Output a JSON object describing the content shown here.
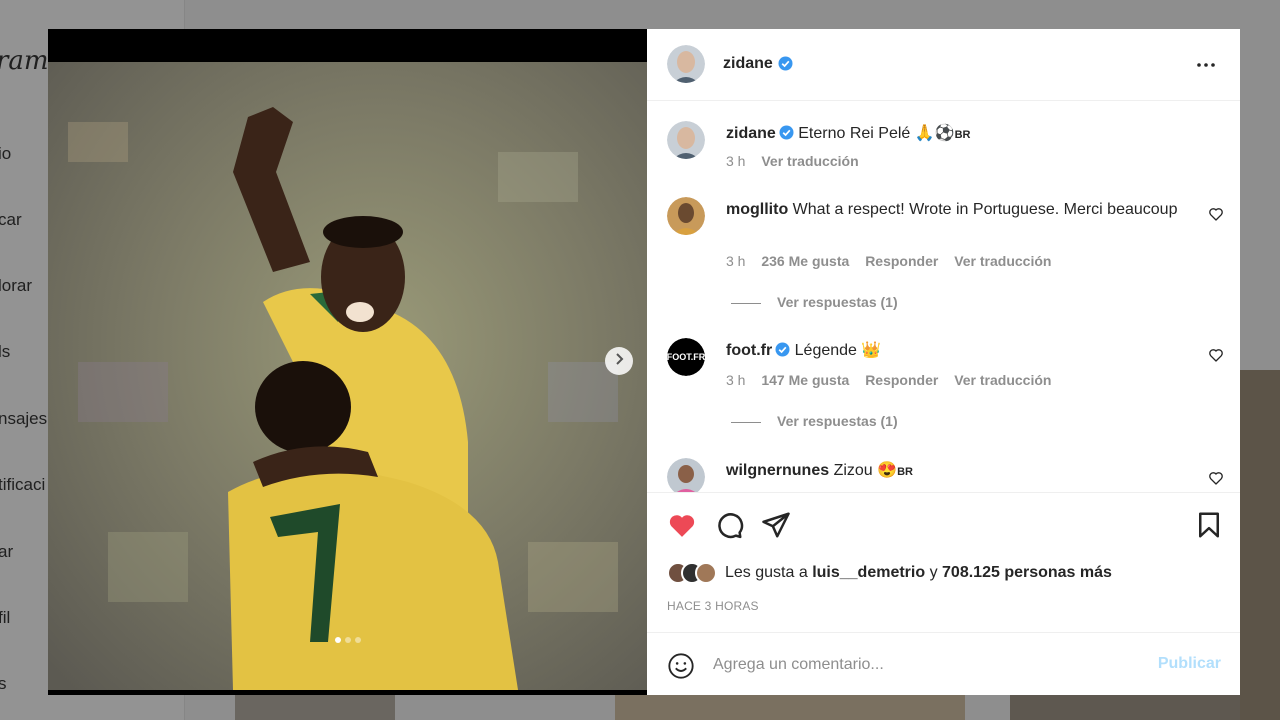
{
  "background": {
    "logo_fragment": "ram",
    "nav_fragments": [
      "io",
      "car",
      "lorar",
      "ls",
      "nsajes",
      "tificaci",
      "ar",
      "fil",
      "s"
    ]
  },
  "post": {
    "author": "zidane",
    "caption": "Eterno Rei Pelé 🙏⚽",
    "caption_flag": "BR",
    "caption_time": "3 h",
    "caption_translate": "Ver traducción",
    "more_icon": "more-horizontal-icon",
    "carousel_dots": 3,
    "carousel_active": 1
  },
  "comments": [
    {
      "username": "mogllito",
      "verified": false,
      "text": "What a respect! Wrote in Portuguese. Merci beaucoup",
      "time": "3 h",
      "likes": "236 Me gusta",
      "reply": "Responder",
      "translate": "Ver traducción",
      "view_replies": "Ver respuestas (1)"
    },
    {
      "username": "foot.fr",
      "verified": true,
      "text": "Légende 👑",
      "time": "3 h",
      "likes": "147 Me gusta",
      "reply": "Responder",
      "translate": "Ver traducción",
      "view_replies": "Ver respuestas (1)"
    },
    {
      "username": "wilgnernunes",
      "verified": false,
      "text": "Zizou 😍",
      "flag": "BR"
    }
  ],
  "likes": {
    "prefix": "Les gusta a",
    "user": "luis__demetrio",
    "joiner": "y",
    "others": "708.125 personas más"
  },
  "time_ago": "HACE 3 HORAS",
  "comment_box": {
    "placeholder": "Agrega un comentario...",
    "publish": "Publicar"
  },
  "colors": {
    "like_red": "#ed4956",
    "verified_blue": "#3897f0",
    "publish_disabled": "#b2dffc"
  }
}
